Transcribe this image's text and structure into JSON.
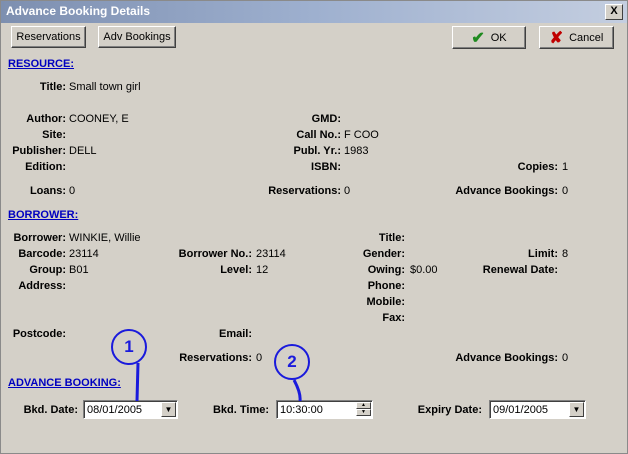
{
  "window": {
    "title": "Advance Booking Details",
    "close_glyph": "X"
  },
  "toolbar": {
    "reservations": "Reservations",
    "adv_bookings": "Adv Bookings",
    "ok": "OK",
    "cancel": "Cancel"
  },
  "resource": {
    "heading": "RESOURCE:",
    "title_label": "Title:",
    "title": "Small town girl",
    "author_label": "Author:",
    "author": "COONEY, E",
    "site_label": "Site:",
    "site": "",
    "publisher_label": "Publisher:",
    "publisher": "DELL",
    "edition_label": "Edition:",
    "edition": "",
    "gmd_label": "GMD:",
    "gmd": "",
    "callno_label": "Call No.:",
    "callno": "F COO",
    "publyr_label": "Publ. Yr.:",
    "publyr": "1983",
    "isbn_label": "ISBN:",
    "isbn": "",
    "copies_label": "Copies:",
    "copies": "1",
    "loans_label": "Loans:",
    "loans": "0",
    "reservations_label": "Reservations:",
    "reservations": "0",
    "advbook_label": "Advance Bookings:",
    "advbook": "0"
  },
  "borrower": {
    "heading": "BORROWER:",
    "borrower_label": "Borrower:",
    "borrower": "WINKIE, Willie",
    "barcode_label": "Barcode:",
    "barcode": "23114",
    "group_label": "Group:",
    "group": "B01",
    "address_label": "Address:",
    "address": "",
    "borrowerno_label": "Borrower No.:",
    "borrowerno": "23114",
    "level_label": "Level:",
    "level": "12",
    "title_label": "Title:",
    "title": "",
    "gender_label": "Gender:",
    "gender": "",
    "owing_label": "Owing:",
    "owing": "$0.00",
    "phone_label": "Phone:",
    "phone": "",
    "mobile_label": "Mobile:",
    "mobile": "",
    "fax_label": "Fax:",
    "fax": "",
    "limit_label": "Limit:",
    "limit": "8",
    "renewal_label": "Renewal Date:",
    "renewal": "",
    "postcode_label": "Postcode:",
    "postcode": "",
    "email_label": "Email:",
    "email": "",
    "reservations_label": "Reservations:",
    "reservations": "0",
    "advbook_label": "Advance Bookings:",
    "advbook": "0"
  },
  "advance": {
    "heading": "ADVANCE BOOKING:",
    "bkd_date_label": "Bkd. Date:",
    "bkd_date": "08/01/2005",
    "bkd_time_label": "Bkd. Time:",
    "bkd_time": "10:30:00",
    "expiry_label": "Expiry Date:",
    "expiry": "09/01/2005"
  },
  "callouts": {
    "one": "1",
    "two": "2"
  },
  "colors": {
    "heading": "#0000c0",
    "callout": "#1a1adc",
    "ok_check": "#1f8a1f",
    "cancel_x": "#c00000"
  }
}
